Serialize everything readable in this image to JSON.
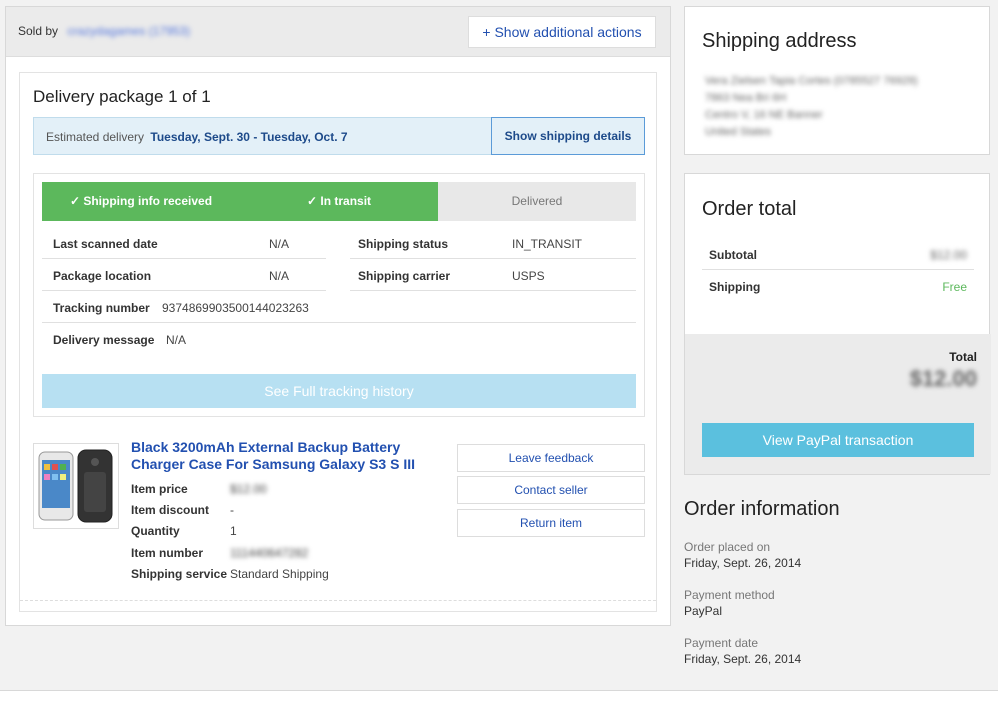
{
  "seller": {
    "sold_by_label": "Sold by",
    "seller_name": "crazydagames (17953)",
    "additional_actions_label": "+ Show additional actions"
  },
  "package": {
    "title": "Delivery package 1 of 1",
    "estimated_label": "Estimated delivery",
    "estimated_range": "Tuesday, Sept. 30 - Tuesday, Oct. 7",
    "show_details_label": "Show shipping details",
    "progress": [
      {
        "label": "✓ Shipping info received",
        "state": "done"
      },
      {
        "label": "✓ In transit",
        "state": "done"
      },
      {
        "label": "Delivered",
        "state": "pending"
      }
    ],
    "info": {
      "last_scanned_label": "Last scanned date",
      "last_scanned_value": "N/A",
      "shipping_status_label": "Shipping status",
      "shipping_status_value": "IN_TRANSIT",
      "package_location_label": "Package location",
      "package_location_value": "N/A",
      "shipping_carrier_label": "Shipping carrier",
      "shipping_carrier_value": "USPS",
      "tracking_label": "Tracking number",
      "tracking_value": "9374869903500144023263",
      "delivery_msg_label": "Delivery message",
      "delivery_msg_value": "N/A"
    },
    "history_button": "See Full tracking history"
  },
  "item": {
    "title": "Black 3200mAh External Backup Battery Charger Case For Samsung Galaxy S3 S III",
    "price_label": "Item price",
    "price_value": "$12.00",
    "discount_label": "Item discount",
    "discount_value": "-",
    "quantity_label": "Quantity",
    "quantity_value": "1",
    "number_label": "Item number",
    "number_value": "111440647282",
    "service_label": "Shipping service",
    "service_value": "Standard Shipping",
    "actions": [
      "Leave feedback",
      "Contact seller",
      "Return item"
    ]
  },
  "shipping_address": {
    "title": "Shipping address",
    "lines": [
      "Vera Zielsen Tapia Cortes (0785527 76929)",
      "7863 Nea Bri 6H",
      "Centro V, 16 NE Banner",
      "United States"
    ]
  },
  "order_total": {
    "title": "Order total",
    "subtotal_label": "Subtotal",
    "subtotal_value": "$12.00",
    "shipping_label": "Shipping",
    "shipping_value": "Free",
    "total_label": "Total",
    "total_value": "$12.00",
    "paypal_button": "View PayPal transaction"
  },
  "order_info": {
    "title": "Order information",
    "placed_label": "Order placed on",
    "placed_value": "Friday, Sept. 26, 2014",
    "method_label": "Payment method",
    "method_value": "PayPal",
    "date_label": "Payment date",
    "date_value": "Friday, Sept. 26, 2014"
  },
  "colors": {
    "link": "#2250b0",
    "success": "#5cb85c",
    "paypal": "#5bc0de",
    "free": "#5cb85c"
  }
}
